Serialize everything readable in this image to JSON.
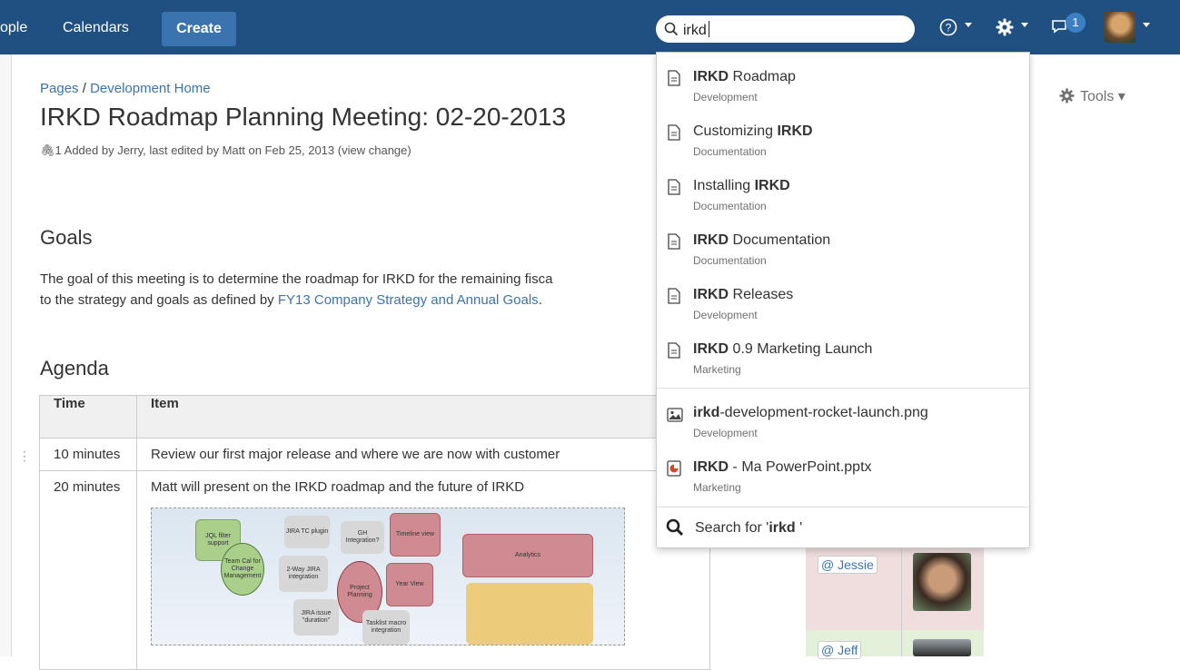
{
  "nav": {
    "people_label": "ople",
    "calendars_label": "Calendars",
    "create_label": "Create",
    "search_value": "irkd",
    "notification_count": "1"
  },
  "breadcrumb": {
    "root": "Pages",
    "separator": "/",
    "parent": "Development Home"
  },
  "page": {
    "title": "IRKD Roadmap Planning Meeting: 02-20-2013",
    "attachment_count": "1",
    "byline": "Added by Jerry, last edited by Matt on Feb 25, 2013",
    "view_change": "(view change)",
    "tools_label": "Tools ▾"
  },
  "goals": {
    "heading": "Goals",
    "line1": "The goal of this meeting is to determine the roadmap for IRKD for the remaining fisca",
    "line2_prefix": "to the strategy and goals as defined by ",
    "line2_link": "FY13 Company Strategy and Annual Goals",
    "line2_suffix": "."
  },
  "agenda": {
    "heading": "Agenda",
    "headers": {
      "time": "Time",
      "item": "Item"
    },
    "rows": [
      {
        "time": "10 minutes",
        "item": "Review our first major release and where we are now with customer"
      },
      {
        "time": "20 minutes",
        "item": "Matt will present on the IRKD roadmap and the future of IRKD"
      }
    ],
    "diagram_labels": {
      "jql": "JQL filter support",
      "jira_tc": "JIRA TC plugin",
      "gh": "GH Integration?",
      "timeline": "Timeline view",
      "analytics": "Analytics",
      "team_cal": "Team Cal for Change Management",
      "two_way": "2-Way JIRA integration",
      "project_planning": "Project Planning",
      "year_view": "Year View",
      "jira_issue": "JIRA issue \"duration\"",
      "tasklist": "Tasklist macro integration"
    }
  },
  "people": {
    "jessie": "@ Jessie",
    "jeff": "@ Jeff"
  },
  "dropdown": {
    "results": [
      {
        "bold": "IRKD",
        "rest": " Roadmap",
        "space": "Development",
        "icon": "page-icon"
      },
      {
        "pre": "Customizing ",
        "bold": "IRKD",
        "space": "Documentation",
        "icon": "page-icon"
      },
      {
        "pre": "Installing ",
        "bold": "IRKD",
        "space": "Documentation",
        "icon": "page-icon"
      },
      {
        "bold": "IRKD",
        "rest": " Documentation",
        "space": "Documentation",
        "icon": "page-icon"
      },
      {
        "bold": "IRKD",
        "rest": " Releases",
        "space": "Development",
        "icon": "page-icon"
      },
      {
        "bold": "IRKD",
        "rest": " 0.9 Marketing Launch",
        "space": "Marketing",
        "icon": "page-icon"
      },
      {
        "bold": "irkd",
        "rest": "-development-rocket-launch.png",
        "space": "Development",
        "icon": "image-icon"
      },
      {
        "bold": "IRKD",
        "rest": " - Ma PowerPoint.pptx",
        "space": "Marketing",
        "icon": "powerpoint-icon"
      }
    ],
    "search_for_prefix": "Search for '",
    "search_for_term": "irkd",
    "search_for_suffix": " '"
  },
  "colors": {
    "nav_bg": "#205081",
    "create_bg": "#3b73af",
    "link": "#3b73af"
  }
}
